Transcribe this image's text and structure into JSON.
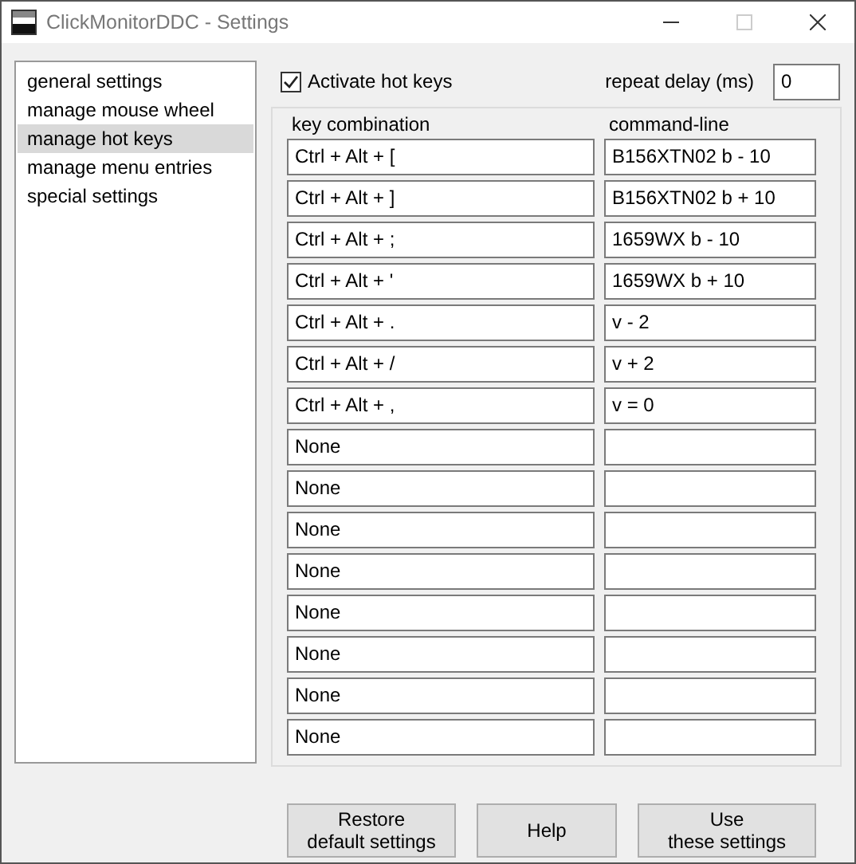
{
  "window": {
    "title": "ClickMonitorDDC - Settings"
  },
  "sidebar": {
    "items": [
      {
        "label": "general settings",
        "selected": false
      },
      {
        "label": "manage mouse wheel",
        "selected": false
      },
      {
        "label": "manage hot keys",
        "selected": true
      },
      {
        "label": "manage menu entries",
        "selected": false
      },
      {
        "label": "special settings",
        "selected": false
      }
    ]
  },
  "activate": {
    "label": "Activate hot keys",
    "checked": true
  },
  "repeat_delay": {
    "label": "repeat delay (ms)",
    "value": "0"
  },
  "table": {
    "columns": [
      "key combination",
      "command-line"
    ],
    "rows": [
      [
        "Ctrl + Alt + [",
        "B156XTN02 b - 10"
      ],
      [
        "Ctrl + Alt + ]",
        "B156XTN02 b + 10"
      ],
      [
        "Ctrl + Alt + ;",
        "1659WX b - 10"
      ],
      [
        "Ctrl + Alt + '",
        "1659WX b + 10"
      ],
      [
        "Ctrl + Alt + .",
        "v - 2"
      ],
      [
        "Ctrl + Alt + /",
        "v + 2"
      ],
      [
        "Ctrl + Alt + ,",
        "v = 0"
      ],
      [
        "None",
        ""
      ],
      [
        "None",
        ""
      ],
      [
        "None",
        ""
      ],
      [
        "None",
        ""
      ],
      [
        "None",
        ""
      ],
      [
        "None",
        ""
      ],
      [
        "None",
        ""
      ],
      [
        "None",
        ""
      ]
    ]
  },
  "buttons": [
    "Restore\ndefault settings",
    "Help",
    "Use\nthese settings"
  ]
}
